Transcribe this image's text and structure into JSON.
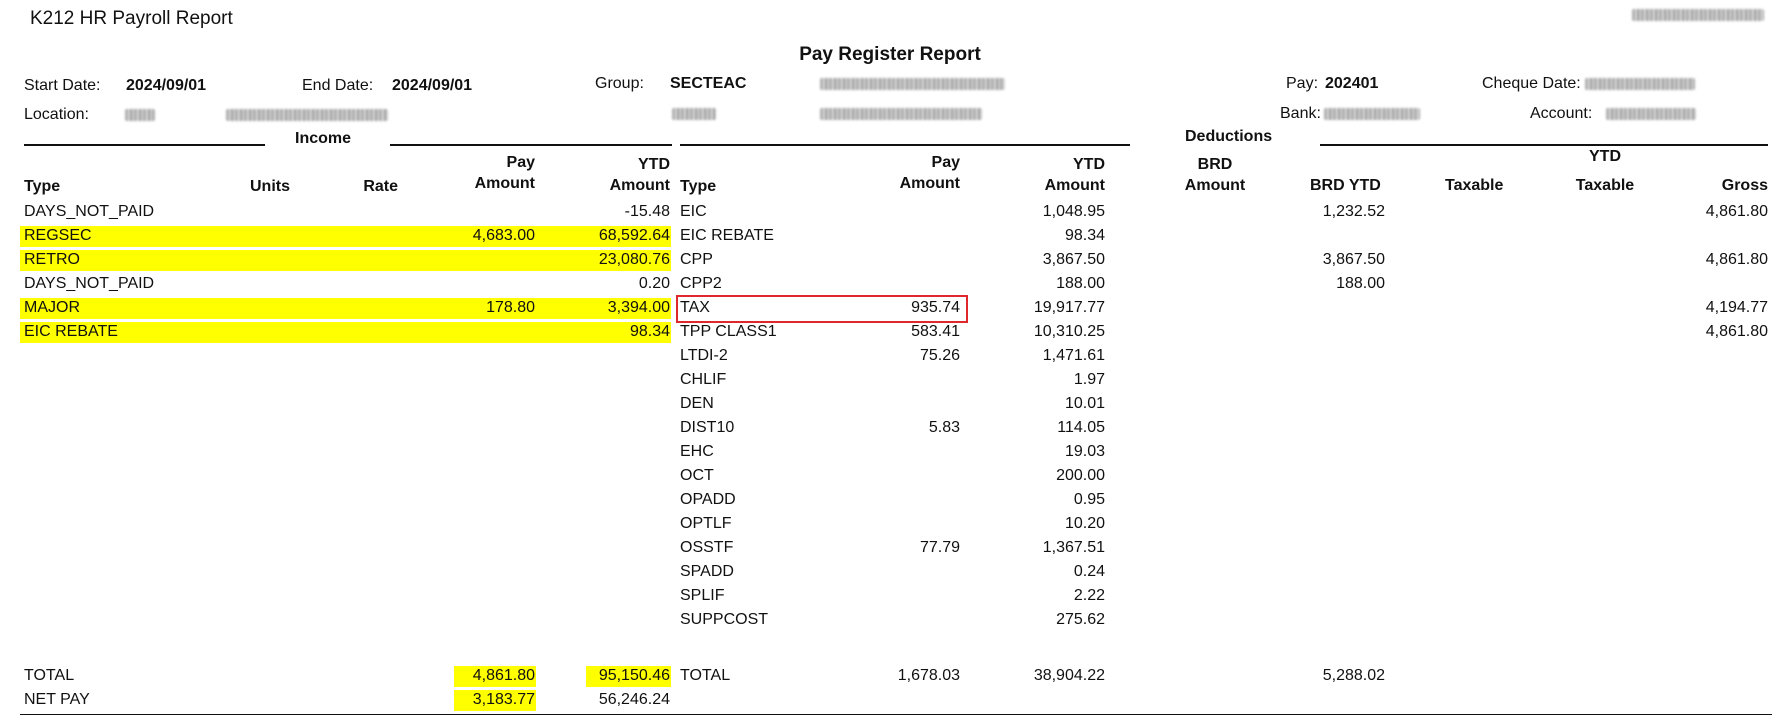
{
  "app_title": "K212 HR Payroll Report",
  "report_title": "Pay Register Report",
  "header": {
    "start_date_label": "Start Date:",
    "start_date": "2024/09/01",
    "end_date_label": "End Date:",
    "end_date": "2024/09/01",
    "group_label": "Group:",
    "group_code": "SECTEAC",
    "pay_label": "Pay:",
    "pay_value": "202401",
    "cheque_date_label": "Cheque Date:",
    "location_label": "Location:",
    "bank_label": "Bank:",
    "account_label": "Account:"
  },
  "sections": {
    "income": "Income",
    "deductions": "Deductions"
  },
  "income_columns": {
    "type": "Type",
    "units": "Units",
    "rate": "Rate",
    "pay_amount_1": "Pay",
    "pay_amount_2": "Amount",
    "ytd_amount_1": "YTD",
    "ytd_amount_2": "Amount"
  },
  "deduction_columns": {
    "type": "Type",
    "pay_amount_1": "Pay",
    "pay_amount_2": "Amount",
    "ytd_amount_1": "YTD",
    "ytd_amount_2": "Amount",
    "brd_amount_1": "BRD",
    "brd_amount_2": "Amount",
    "brd_ytd": "BRD YTD",
    "taxable": "Taxable",
    "ytd_taxable_1": "YTD",
    "ytd_taxable_2": "Taxable",
    "gross": "Gross"
  },
  "income_rows": [
    {
      "type": "DAYS_NOT_PAID",
      "pay": "",
      "ytd": "-15.48",
      "highlight": false
    },
    {
      "type": "REGSEC",
      "pay": "4,683.00",
      "ytd": "68,592.64",
      "highlight": true
    },
    {
      "type": "RETRO",
      "pay": "",
      "ytd": "23,080.76",
      "highlight": true
    },
    {
      "type": "DAYS_NOT_PAID",
      "pay": "",
      "ytd": "0.20",
      "highlight": false
    },
    {
      "type": "MAJOR",
      "pay": "178.80",
      "ytd": "3,394.00",
      "highlight": true
    },
    {
      "type": "EIC REBATE",
      "pay": "",
      "ytd": "98.34",
      "highlight": true
    }
  ],
  "deduction_rows": [
    {
      "type": "EIC",
      "pay": "",
      "ytd": "1,048.95",
      "brd_ytd": "1,232.52",
      "gross": "4,861.80"
    },
    {
      "type": "EIC REBATE",
      "pay": "",
      "ytd": "98.34",
      "brd_ytd": "",
      "gross": ""
    },
    {
      "type": "CPP",
      "pay": "",
      "ytd": "3,867.50",
      "brd_ytd": "3,867.50",
      "gross": "4,861.80"
    },
    {
      "type": "CPP2",
      "pay": "",
      "ytd": "188.00",
      "brd_ytd": "188.00",
      "gross": ""
    },
    {
      "type": "TAX",
      "pay": "935.74",
      "ytd": "19,917.77",
      "brd_ytd": "",
      "gross": "4,194.77"
    },
    {
      "type": "TPP CLASS1",
      "pay": "583.41",
      "ytd": "10,310.25",
      "brd_ytd": "",
      "gross": "4,861.80"
    },
    {
      "type": "LTDI-2",
      "pay": "75.26",
      "ytd": "1,471.61",
      "brd_ytd": "",
      "gross": ""
    },
    {
      "type": "CHLIF",
      "pay": "",
      "ytd": "1.97",
      "brd_ytd": "",
      "gross": ""
    },
    {
      "type": "DEN",
      "pay": "",
      "ytd": "10.01",
      "brd_ytd": "",
      "gross": ""
    },
    {
      "type": "DIST10",
      "pay": "5.83",
      "ytd": "114.05",
      "brd_ytd": "",
      "gross": ""
    },
    {
      "type": "EHC",
      "pay": "",
      "ytd": "19.03",
      "brd_ytd": "",
      "gross": ""
    },
    {
      "type": "OCT",
      "pay": "",
      "ytd": "200.00",
      "brd_ytd": "",
      "gross": ""
    },
    {
      "type": "OPADD",
      "pay": "",
      "ytd": "0.95",
      "brd_ytd": "",
      "gross": ""
    },
    {
      "type": "OPTLF",
      "pay": "",
      "ytd": "10.20",
      "brd_ytd": "",
      "gross": ""
    },
    {
      "type": "OSSTF",
      "pay": "77.79",
      "ytd": "1,367.51",
      "brd_ytd": "",
      "gross": ""
    },
    {
      "type": "SPADD",
      "pay": "",
      "ytd": "0.24",
      "brd_ytd": "",
      "gross": ""
    },
    {
      "type": "SPLIF",
      "pay": "",
      "ytd": "2.22",
      "brd_ytd": "",
      "gross": ""
    },
    {
      "type": "SUPPCOST",
      "pay": "",
      "ytd": "275.62",
      "brd_ytd": "",
      "gross": ""
    }
  ],
  "totals": {
    "total_label": "TOTAL",
    "net_pay_label": "NET PAY",
    "income_total_pay": "4,861.80",
    "income_total_ytd": "95,150.46",
    "net_pay_pay": "3,183.77",
    "net_pay_ytd": "56,246.24",
    "deduction_total_label": "TOTAL",
    "deduction_total_pay": "1,678.03",
    "deduction_total_ytd": "38,904.22",
    "deduction_total_brd_ytd": "5,288.02"
  },
  "colors": {
    "highlight": "#ffff00",
    "callout_border": "#e0272c"
  }
}
